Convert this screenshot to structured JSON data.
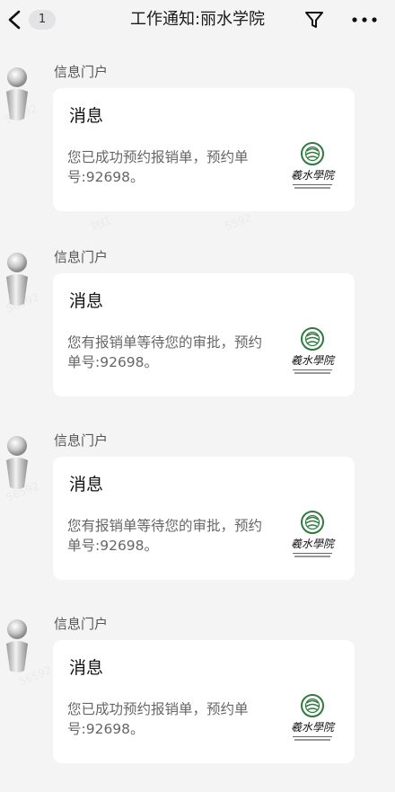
{
  "header": {
    "back_badge": "1",
    "title": "工作通知:丽水学院",
    "back_icon": "chevron-left-icon",
    "filter_icon": "filter-icon",
    "more_icon": "more-horizontal-icon"
  },
  "messages": [
    {
      "sender": "信息门户",
      "title": "消息",
      "body": "您已成功预约报销单，预约单号:92698。"
    },
    {
      "sender": "信息门户",
      "title": "消息",
      "body": "您有报销单等待您的审批，预约单号:92698。"
    },
    {
      "sender": "信息门户",
      "title": "消息",
      "body": "您有报销单等待您的审批，预约单号:92698。"
    },
    {
      "sender": "信息门户",
      "title": "消息",
      "body": "您已成功预约报销单，预约单号:92698。"
    }
  ],
  "colors": {
    "background": "#f4f4f5",
    "card": "#ffffff",
    "logo_green": "#2f7a3d"
  }
}
